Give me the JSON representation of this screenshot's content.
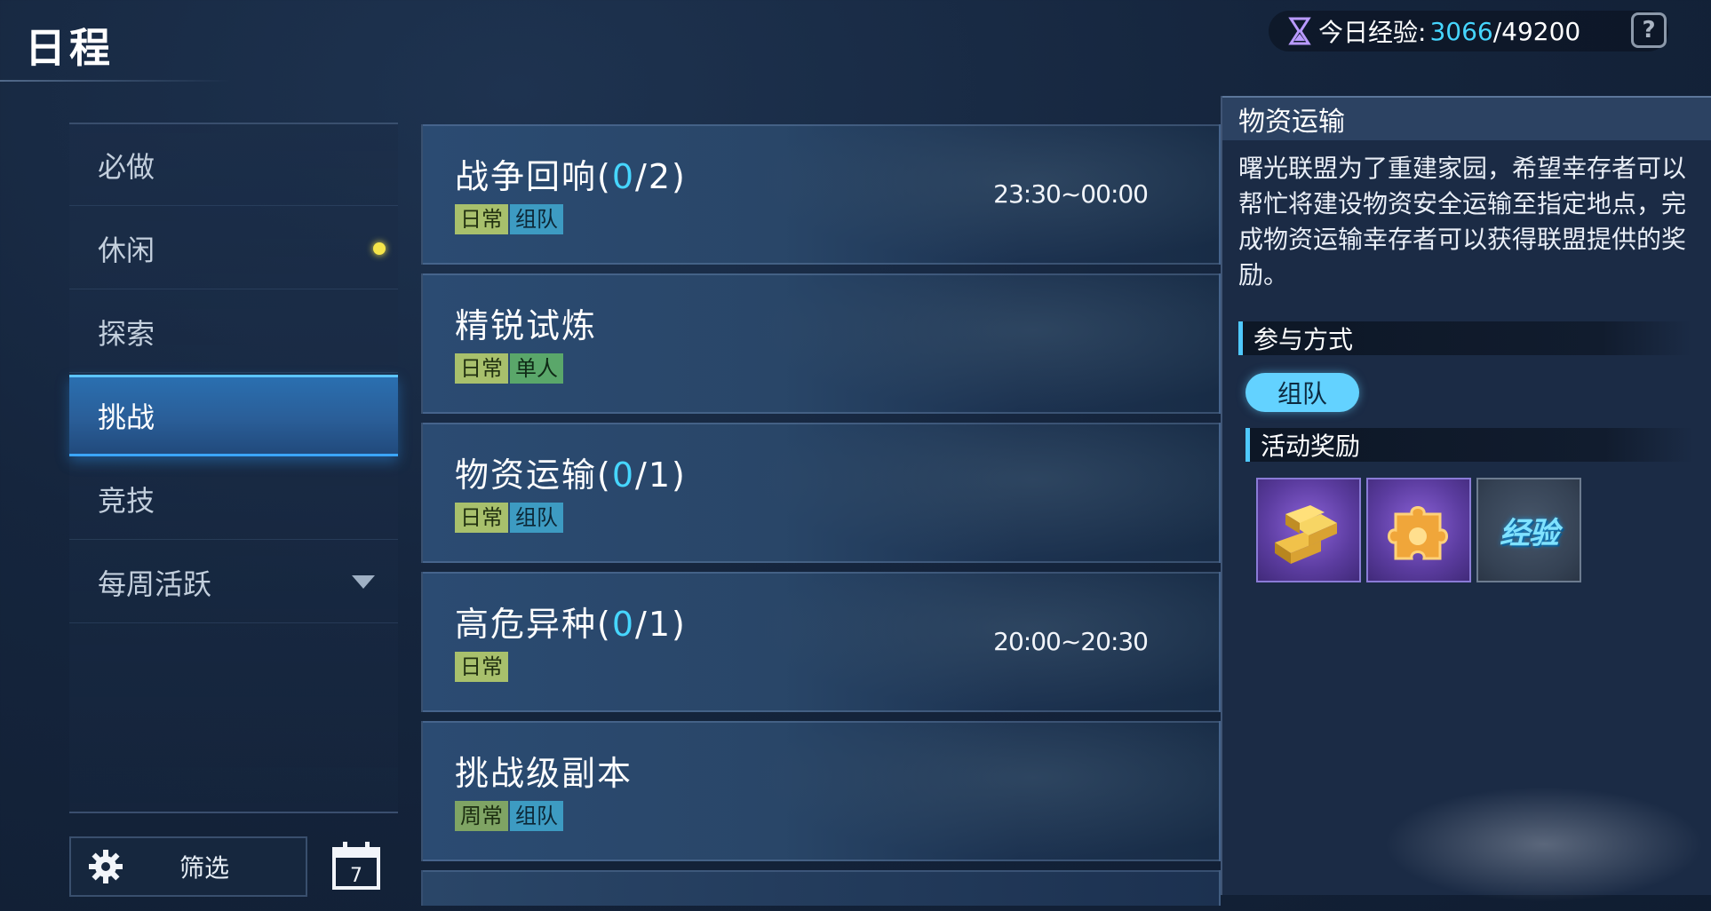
{
  "header": {
    "title": "日程",
    "exp_label": "今日经验:",
    "exp_current": "3066",
    "exp_separator": "/",
    "exp_total": "49200",
    "help_icon": "?"
  },
  "sidebar": {
    "items": [
      {
        "label": "必做",
        "active": false
      },
      {
        "label": "休闲",
        "active": false,
        "notification": true
      },
      {
        "label": "探索",
        "active": false
      },
      {
        "label": "挑战",
        "active": true
      },
      {
        "label": "竞技",
        "active": false
      },
      {
        "label": "每周活跃",
        "active": false,
        "expandable": true
      }
    ],
    "filter_label": "筛选",
    "calendar_day": "7"
  },
  "events": [
    {
      "name": "战争回响",
      "progress_open": "(",
      "progress_done": "0",
      "progress_total": "/2)",
      "tags": [
        "日常",
        "组队"
      ],
      "time": "23:30~00:00"
    },
    {
      "name": "精锐试炼",
      "tags": [
        "日常",
        "单人"
      ]
    },
    {
      "name": "物资运输",
      "progress_open": "(",
      "progress_done": "0",
      "progress_total": "/1)",
      "tags": [
        "日常",
        "组队"
      ]
    },
    {
      "name": "高危异种",
      "progress_open": "(",
      "progress_done": "0",
      "progress_total": "/1)",
      "tags": [
        "日常"
      ],
      "time": "20:00~20:30"
    },
    {
      "name": "挑战级副本",
      "tags": [
        "周常",
        "组队"
      ]
    }
  ],
  "detail": {
    "title": "物资运输",
    "description": "曙光联盟为了重建家园，希望幸存者可以帮忙将建设物资安全运输至指定地点，完成物资运输幸存者可以获得联盟提供的奖励。",
    "participation_heading": "参与方式",
    "participation_mode": "组队",
    "rewards_heading": "活动奖励",
    "rewards": [
      {
        "icon": "gold-bars-icon"
      },
      {
        "icon": "puzzle-piece-icon"
      },
      {
        "icon": "exp-icon",
        "text": "经验"
      }
    ]
  },
  "colors": {
    "accent": "#46d6ff",
    "tag_daily": "#a8c06c",
    "tag_team": "#3d9bc2",
    "tag_solo": "#5aa76a",
    "notification_dot": "#f5e54a"
  }
}
